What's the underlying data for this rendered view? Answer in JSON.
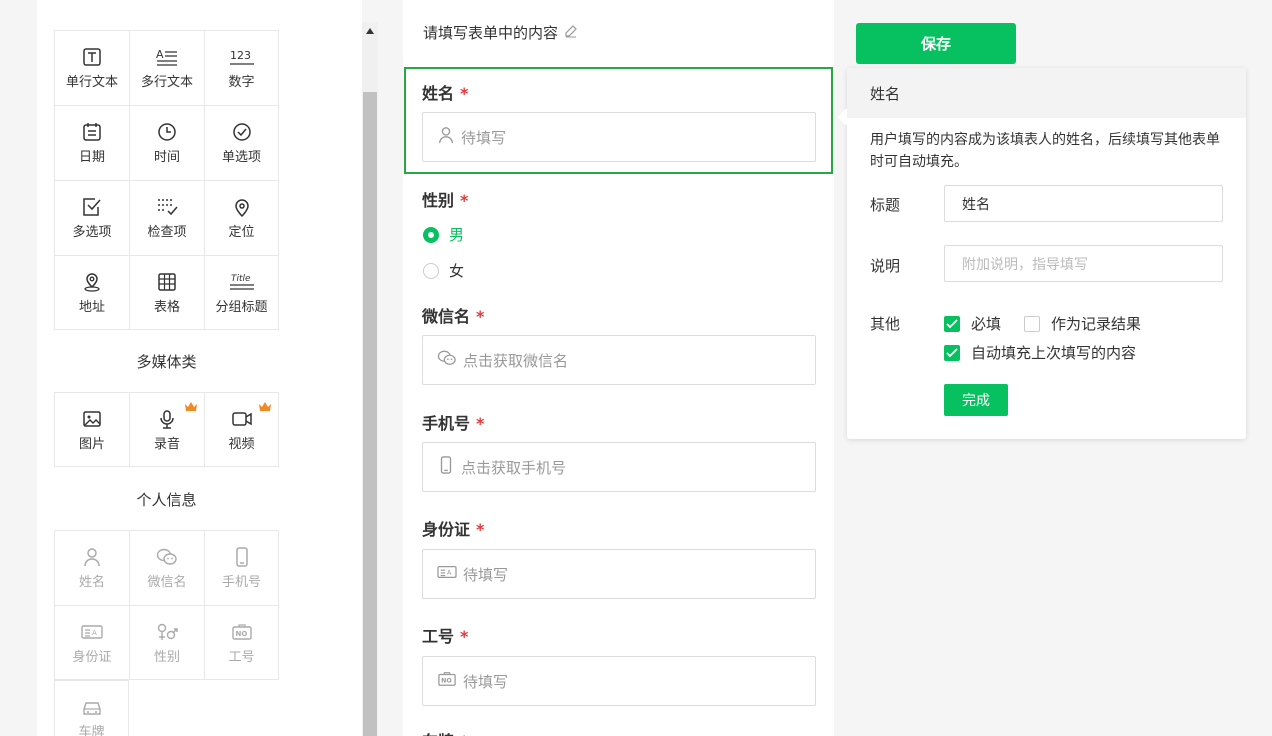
{
  "palette": {
    "basic": [
      {
        "label": "单行文本",
        "icon": "text-box-icon"
      },
      {
        "label": "多行文本",
        "icon": "multiline-text-icon"
      },
      {
        "label": "数字",
        "icon": "number-icon",
        "glyph": "123"
      },
      {
        "label": "日期",
        "icon": "calendar-icon"
      },
      {
        "label": "时间",
        "icon": "clock-icon"
      },
      {
        "label": "单选项",
        "icon": "check-circle-icon"
      },
      {
        "label": "多选项",
        "icon": "checkbox-icon"
      },
      {
        "label": "检查项",
        "icon": "checklist-icon"
      },
      {
        "label": "定位",
        "icon": "location-pin-icon"
      },
      {
        "label": "地址",
        "icon": "map-pin-icon"
      },
      {
        "label": "表格",
        "icon": "table-icon"
      },
      {
        "label": "分组标题",
        "icon": "group-title-icon",
        "glyph": "Title"
      }
    ],
    "media_title": "多媒体类",
    "media": [
      {
        "label": "图片",
        "icon": "image-icon"
      },
      {
        "label": "录音",
        "icon": "microphone-icon",
        "premium": true
      },
      {
        "label": "视频",
        "icon": "video-icon",
        "premium": true
      }
    ],
    "personal_title": "个人信息",
    "personal": [
      {
        "label": "姓名",
        "icon": "person-icon"
      },
      {
        "label": "微信名",
        "icon": "wechat-icon"
      },
      {
        "label": "手机号",
        "icon": "phone-icon"
      },
      {
        "label": "身份证",
        "icon": "id-card-icon"
      },
      {
        "label": "性别",
        "icon": "gender-icon"
      },
      {
        "label": "工号",
        "icon": "employee-id-icon",
        "glyph": "NO"
      },
      {
        "label": "车牌",
        "icon": "car-icon"
      }
    ]
  },
  "form": {
    "header": "请填写表单中的内容",
    "fields": [
      {
        "title": "姓名",
        "required": "*",
        "placeholder": "待填写",
        "icon": "person-icon"
      },
      {
        "title": "性别",
        "required": "*",
        "options": [
          "男",
          "女"
        ],
        "selected": "男"
      },
      {
        "title": "微信名",
        "required": "*",
        "placeholder": "点击获取微信名",
        "icon": "wechat-icon"
      },
      {
        "title": "手机号",
        "required": "*",
        "placeholder": "点击获取手机号",
        "icon": "phone-icon"
      },
      {
        "title": "身份证",
        "required": "*",
        "placeholder": "待填写",
        "icon": "id-card-icon"
      },
      {
        "title": "工号",
        "required": "*",
        "placeholder": "待填写",
        "icon": "employee-id-icon"
      },
      {
        "title": "车牌",
        "required": "*"
      }
    ]
  },
  "toolbar": {
    "save_label": "保存"
  },
  "properties": {
    "header": "姓名",
    "description": "用户填写的内容成为该填表人的姓名，后续填写其他表单时可自动填充。",
    "title_label": "标题",
    "title_value": "姓名",
    "desc_label": "说明",
    "desc_placeholder": "附加说明，指导填写",
    "other_label": "其他",
    "checks": [
      {
        "label": "必填",
        "checked": true
      },
      {
        "label": "作为记录结果",
        "checked": false
      },
      {
        "label": "自动填充上次填写的内容",
        "checked": true
      }
    ],
    "done_label": "完成"
  },
  "colors": {
    "accent": "#07c160",
    "required": "#e5393c",
    "selected_border": "#28a745"
  }
}
